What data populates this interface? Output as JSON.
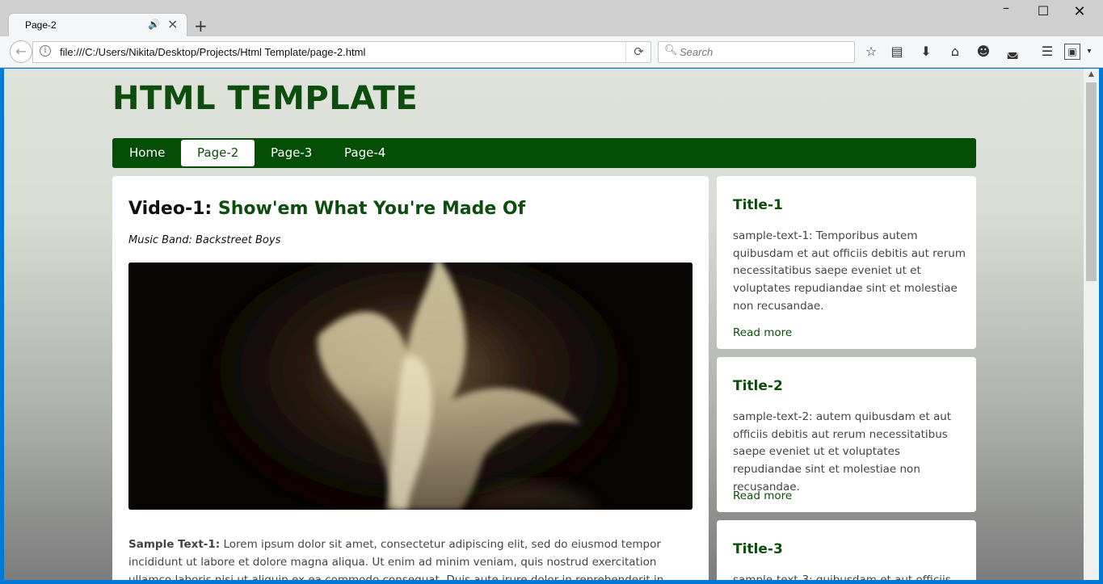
{
  "browser": {
    "tab_title": "Page-2",
    "new_tab_symbol": "+",
    "url": "file:///C:/Users/Nikita/Desktop/Projects/Html Template/page-2.html",
    "search_placeholder": "Search",
    "window_controls": {
      "minimize": "–",
      "maximize": "☐",
      "close": "✕"
    },
    "toolbar_icons": [
      "bookmark-star-icon",
      "reading-list-icon",
      "download-icon",
      "home-icon",
      "smiley-icon",
      "pocket-icon",
      "menu-icon",
      "extension-icon"
    ]
  },
  "page": {
    "site_title": "HTML TEMPLATE",
    "nav": [
      {
        "label": "Home",
        "active": false
      },
      {
        "label": "Page-2",
        "active": true
      },
      {
        "label": "Page-3",
        "active": false
      },
      {
        "label": "Page-4",
        "active": false
      }
    ],
    "main": {
      "video_label": "Video-1:",
      "video_song": "Show'em What You're Made Of",
      "band": "Music Band: Backstreet Boys",
      "sample_label": "Sample Text-1:",
      "sample_text": "Lorem ipsum dolor sit amet, consectetur adipiscing elit, sed do eiusmod tempor incididunt ut labore et dolore magna aliqua. Ut enim ad minim veniam, quis nostrud exercitation ullamco laboris nisi ut aliquip ex ea commodo consequat. Duis aute irure dolor in reprehenderit in voluptate velit esse cillum dolore"
    },
    "sidebar": [
      {
        "title": "Title-1",
        "text": "sample-text-1: Temporibus autem quibusdam et aut officiis debitis aut rerum necessitatibus saepe eveniet ut et voluptates repudiandae sint et molestiae non recusandae.",
        "link": "Read more"
      },
      {
        "title": "Title-2",
        "text": "sample-text-2: autem quibusdam et aut officiis debitis aut rerum necessitatibus saepe eveniet ut et voluptates repudiandae sint et molestiae non recusandae.",
        "link": "Read more"
      },
      {
        "title": "Title-3",
        "text": "sample-text-3: quibusdam et aut officiis",
        "link": ""
      }
    ]
  },
  "colors": {
    "brand_green": "#0d4d0d",
    "nav_bg": "#034d04",
    "accent_blue": "#0078d7"
  }
}
